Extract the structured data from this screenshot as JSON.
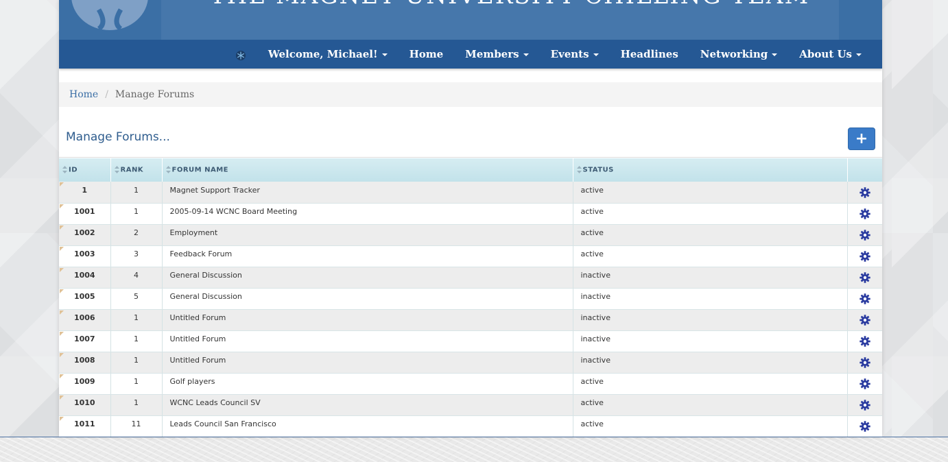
{
  "banner": {
    "title": "THE MAGNET UNIVERSITY CHILLING TEAM"
  },
  "nav": {
    "icon": "snowflake-icon",
    "items": [
      {
        "label": "Welcome, Michael!",
        "dropdown": true
      },
      {
        "label": "Home",
        "dropdown": false
      },
      {
        "label": "Members",
        "dropdown": true
      },
      {
        "label": "Events",
        "dropdown": true
      },
      {
        "label": "Headlines",
        "dropdown": false
      },
      {
        "label": "Networking",
        "dropdown": true
      },
      {
        "label": "About Us",
        "dropdown": true
      }
    ]
  },
  "breadcrumb": {
    "home": "Home",
    "separator": "/",
    "current": "Manage Forums"
  },
  "main": {
    "title": "Manage Forums...",
    "add_label": "+"
  },
  "table": {
    "columns": {
      "id": "ID",
      "rank": "RANK",
      "name": "FORUM NAME",
      "status": "STATUS"
    },
    "rows": [
      {
        "id": "1",
        "rank": "1",
        "name": "Magnet Support Tracker",
        "status": "active"
      },
      {
        "id": "1001",
        "rank": "1",
        "name": "2005-09-14 WCNC Board Meeting",
        "status": "active"
      },
      {
        "id": "1002",
        "rank": "2",
        "name": "Employment",
        "status": "active"
      },
      {
        "id": "1003",
        "rank": "3",
        "name": "Feedback Forum",
        "status": "active"
      },
      {
        "id": "1004",
        "rank": "4",
        "name": "General Discussion",
        "status": "inactive"
      },
      {
        "id": "1005",
        "rank": "5",
        "name": "General Discussion",
        "status": "inactive"
      },
      {
        "id": "1006",
        "rank": "1",
        "name": "Untitled Forum",
        "status": "inactive"
      },
      {
        "id": "1007",
        "rank": "1",
        "name": "Untitled Forum",
        "status": "inactive"
      },
      {
        "id": "1008",
        "rank": "1",
        "name": "Untitled Forum",
        "status": "inactive"
      },
      {
        "id": "1009",
        "rank": "1",
        "name": "Golf players",
        "status": "active"
      },
      {
        "id": "1010",
        "rank": "1",
        "name": "WCNC Leads Council SV",
        "status": "active"
      },
      {
        "id": "1011",
        "rank": "11",
        "name": "Leads Council San Francisco",
        "status": "active"
      }
    ]
  },
  "colors": {
    "banner": "#3b6fa5",
    "navbar": "#255894",
    "accent": "#3a7bc8",
    "gear": "#2a3ba0",
    "table_header": "#cbe7ee"
  }
}
